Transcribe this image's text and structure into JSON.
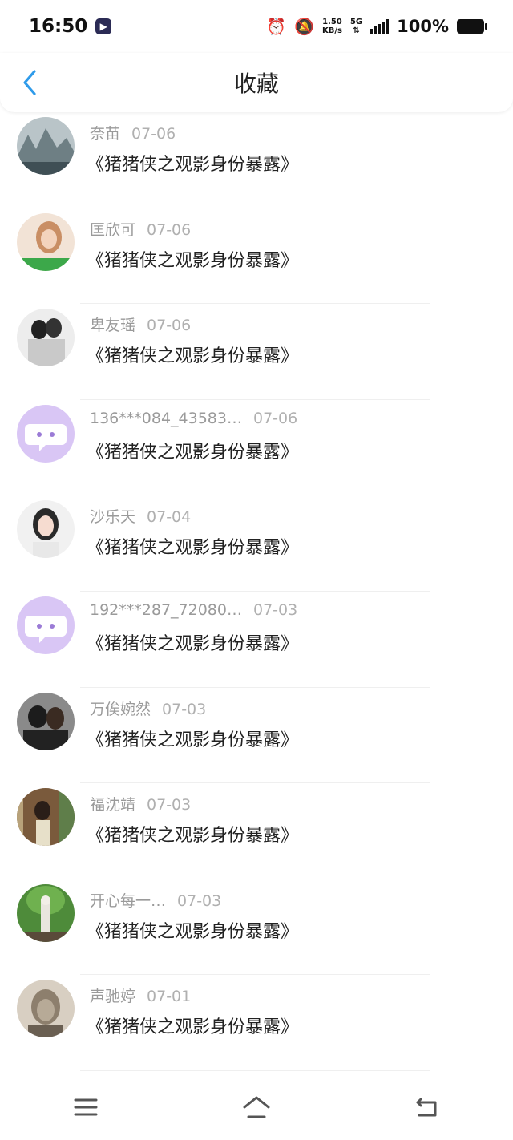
{
  "status_bar": {
    "time": "16:50",
    "net_speed_value": "1.50",
    "net_speed_unit": "KB/s",
    "network": "5G",
    "battery": "100%"
  },
  "header": {
    "title": "收藏"
  },
  "items": [
    {
      "name": "奈苗",
      "date": "07-06",
      "title": "《猪猪侠之观影身份暴露》"
    },
    {
      "name": "匡欣可",
      "date": "07-06",
      "title": "《猪猪侠之观影身份暴露》"
    },
    {
      "name": "卑友瑶",
      "date": "07-06",
      "title": "《猪猪侠之观影身份暴露》"
    },
    {
      "name": "136***084_43583…",
      "date": "07-06",
      "title": "《猪猪侠之观影身份暴露》"
    },
    {
      "name": "沙乐天",
      "date": "07-04",
      "title": "《猪猪侠之观影身份暴露》"
    },
    {
      "name": "192***287_72080…",
      "date": "07-03",
      "title": "《猪猪侠之观影身份暴露》"
    },
    {
      "name": "万俟婉然",
      "date": "07-03",
      "title": "《猪猪侠之观影身份暴露》"
    },
    {
      "name": "福沈靖",
      "date": "07-03",
      "title": "《猪猪侠之观影身份暴露》"
    },
    {
      "name": "开心每一…",
      "date": "07-03",
      "title": "《猪猪侠之观影身份暴露》"
    },
    {
      "name": "声驰婷",
      "date": "07-01",
      "title": "《猪猪侠之观影身份暴露》"
    }
  ],
  "colors": {
    "accent": "#2f9bea",
    "default_avatar": "#d9c6f5"
  }
}
